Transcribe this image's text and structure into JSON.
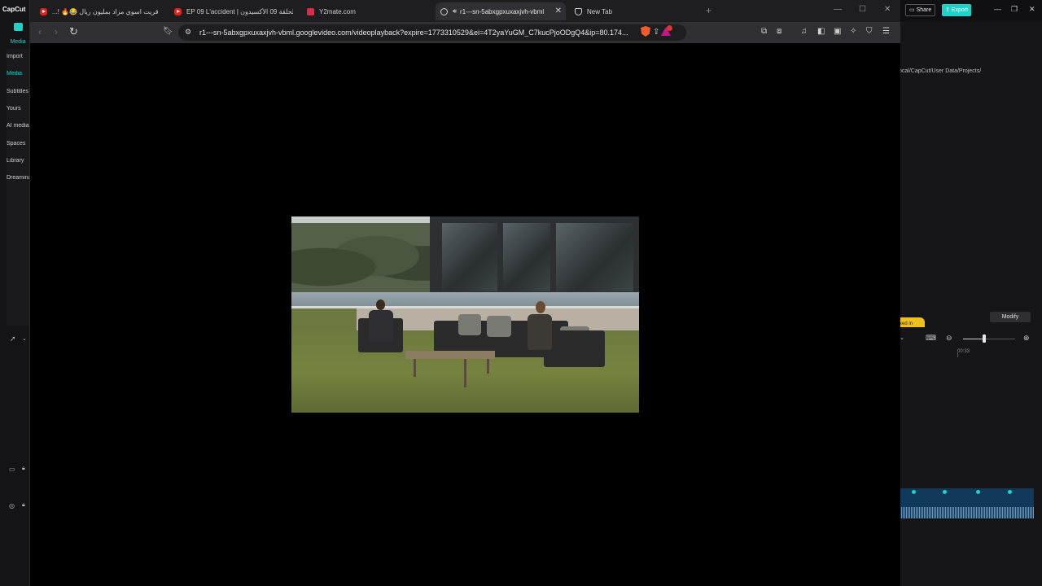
{
  "capcut": {
    "logo": "CapCut",
    "media_label": "Media",
    "sidebar_items": [
      "Import",
      "Media",
      "Subtitles",
      "Yours",
      "AI media",
      "Spaces",
      "Library",
      "Dreamina"
    ],
    "share_label": "Share",
    "export_label": "Export",
    "project_path": "ocal/CapCut/User Data/Projects/",
    "modify_label": "Modify",
    "badge_text": "ked in",
    "timeline_time": "00:33",
    "zoom_slider_level": 0.4,
    "accent_color": "#1fd1c6"
  },
  "browser": {
    "tabs": [
      {
        "title": "قريت اسوي مزاد بمليون ريال 😂🔥 !...",
        "icon": "youtube-icon",
        "active": false
      },
      {
        "title": "EP 09 L'accident | الحلقة 09 الأكسيدون",
        "icon": "youtube-icon",
        "active": false
      },
      {
        "title": "Y2mate.com",
        "icon": "y2mate-icon",
        "active": false
      },
      {
        "title": "r1---sn-5abxgpxuxaxjvh-vbml",
        "icon": "globe-icon",
        "active": true,
        "audio": true
      },
      {
        "title": "New Tab",
        "icon": "brave-shield-icon",
        "active": false
      }
    ],
    "new_tab_symbol": "+",
    "url": "r1---sn-5abxgpxuxaxjvh-vbml.googlevideo.com/videoplayback?expire=1773310529&ei=4T2yaYuGM_C7kucPjoODgQ4&ip=80.174...",
    "rewards_badge": "",
    "colors": {
      "brave": "#f25b2a",
      "chrome": "#303034",
      "tabstrip": "#1e1e21"
    }
  }
}
